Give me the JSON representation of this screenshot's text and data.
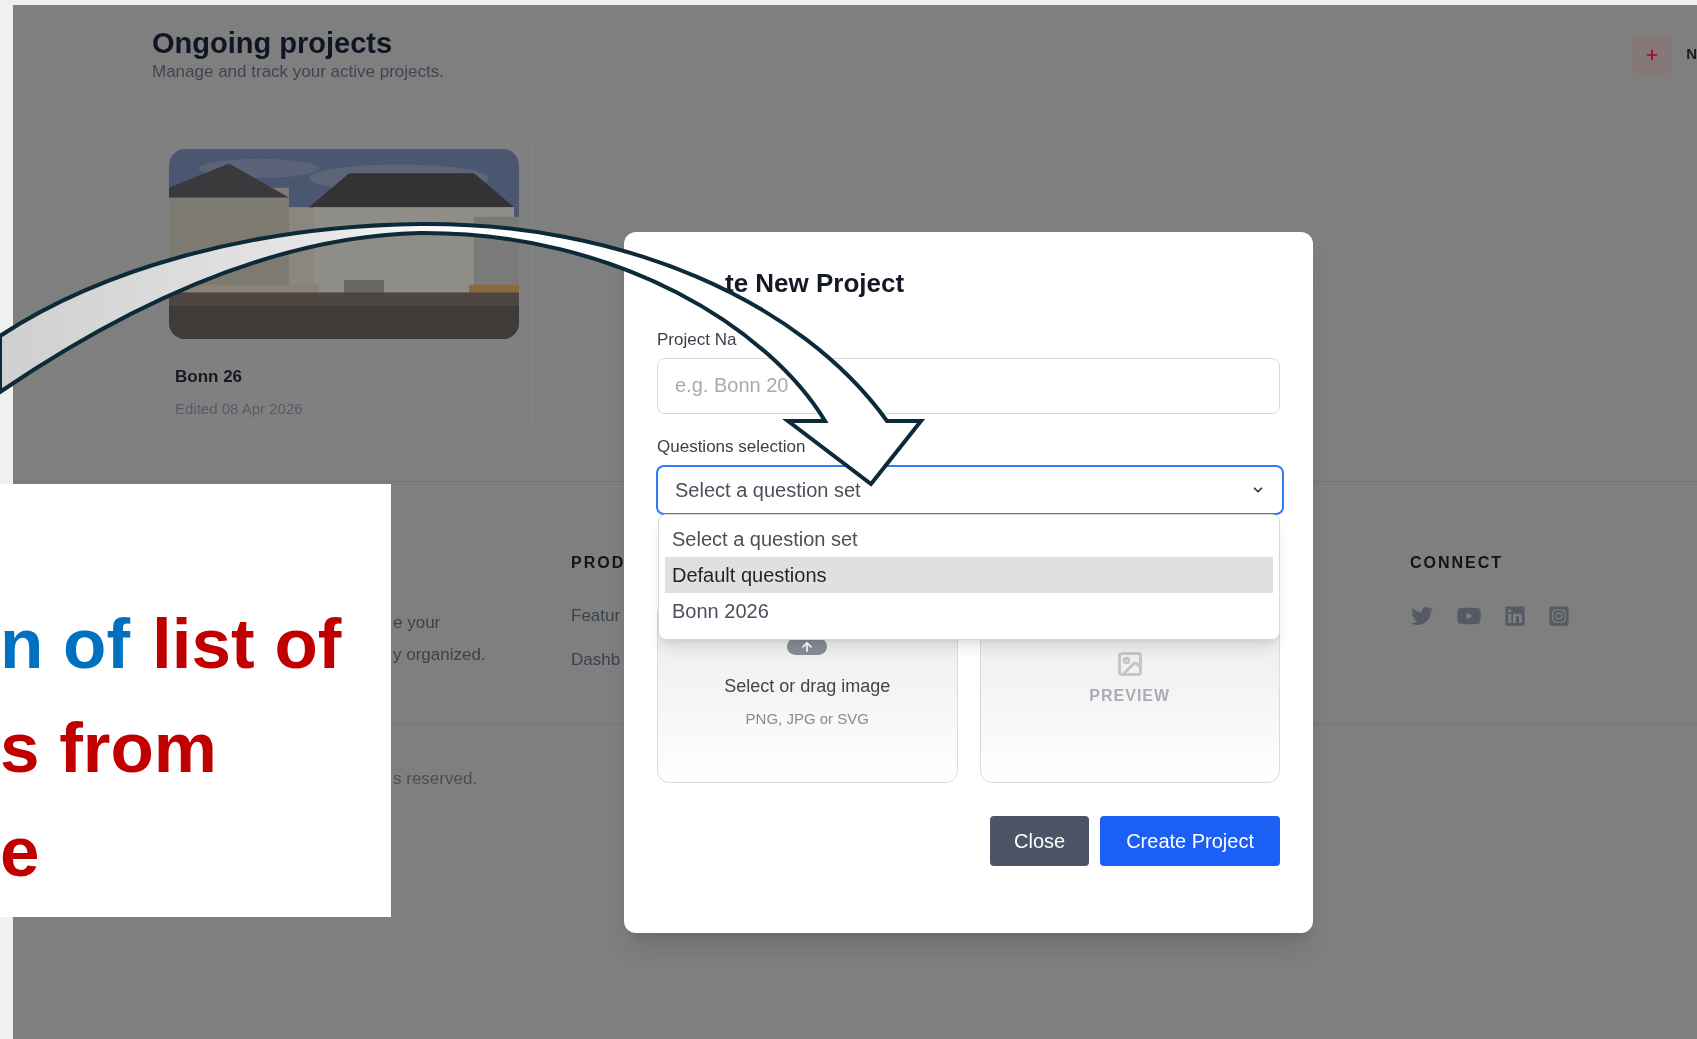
{
  "page": {
    "title": "Ongoing projects",
    "subtitle": "Manage and track your active projects.",
    "new_label": "N"
  },
  "projects": [
    {
      "name": "Bonn 26",
      "edited": "Edited 08 Apr 2026"
    }
  ],
  "footer": {
    "about_lines": [
      "e your",
      "y organized."
    ],
    "product": {
      "heading": "PROD",
      "links": [
        "Featur",
        "Dashb"
      ]
    },
    "connect": {
      "heading": "CONNECT"
    },
    "copyright": "s reserved."
  },
  "modal": {
    "title": "te New Project",
    "name_label": "Project Na",
    "name_placeholder": "e.g. Bonn 20",
    "questions_label": "Questions selection",
    "select_value": "Select a question set",
    "options": [
      {
        "label": "Select a question set",
        "selected": false
      },
      {
        "label": "Default questions",
        "selected": true
      },
      {
        "label": "Bonn 2026",
        "selected": false
      }
    ],
    "upload": {
      "title": "Select or drag image",
      "hint": "PNG, JPG or SVG"
    },
    "preview": "PREVIEW",
    "buttons": [
      {
        "label": "Close",
        "kind": "secondary"
      },
      {
        "label": "Create Project",
        "kind": "primary"
      }
    ]
  },
  "annotation": {
    "lines": [
      [
        {
          "text": "n of",
          "color": "#0070c0"
        },
        {
          "text": "list of",
          "color": "#c00000"
        }
      ],
      [
        {
          "text": "s from",
          "color": "#c00000"
        }
      ],
      [
        {
          "text": "e",
          "color": "#c00000"
        }
      ]
    ]
  }
}
